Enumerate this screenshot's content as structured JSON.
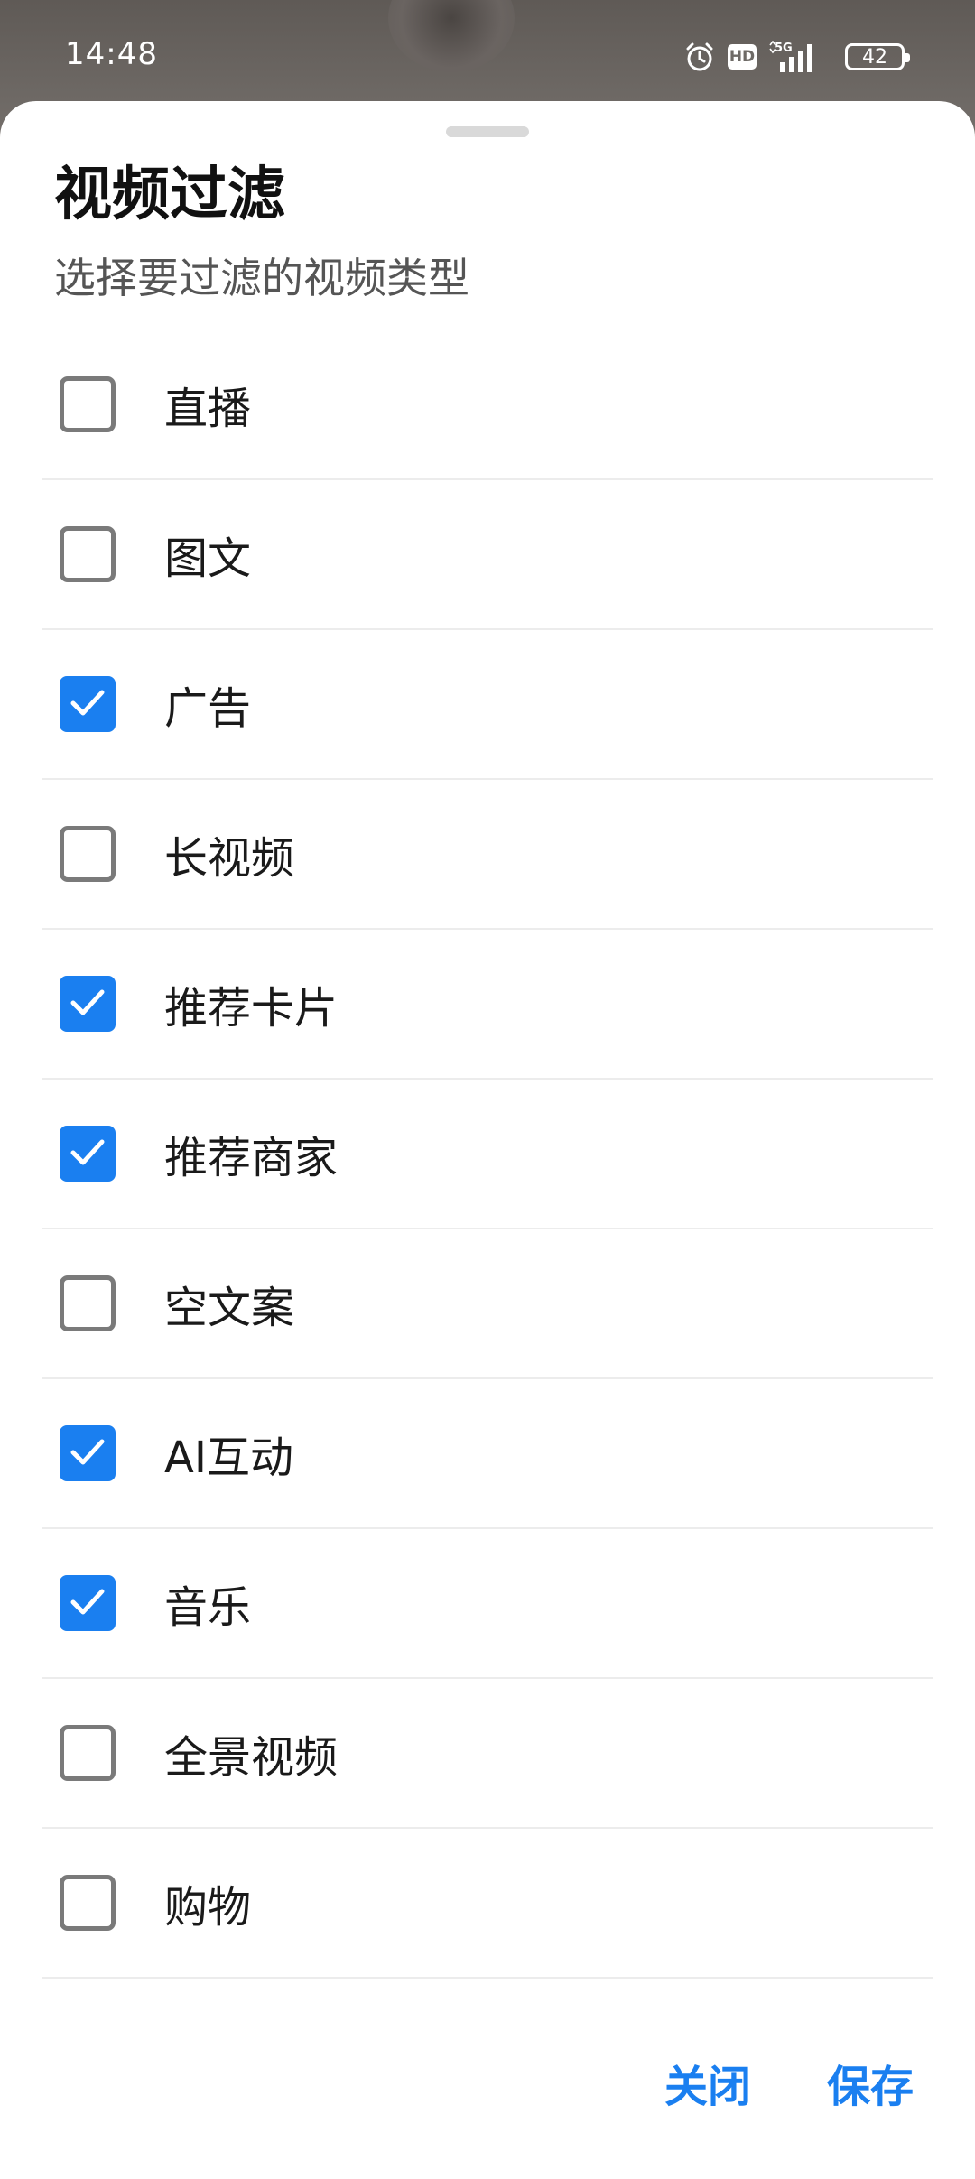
{
  "status_bar": {
    "time": "14:48",
    "battery": "42",
    "hd": "HD",
    "network": "5G",
    "icons": [
      "alarm-icon",
      "hd-icon",
      "signal-5g-icon",
      "battery-icon"
    ]
  },
  "sheet": {
    "title": "视频过滤",
    "subtitle": "选择要过滤的视频类型"
  },
  "filters": [
    {
      "label": "直播",
      "checked": false
    },
    {
      "label": "图文",
      "checked": false
    },
    {
      "label": "广告",
      "checked": true
    },
    {
      "label": "长视频",
      "checked": false
    },
    {
      "label": "推荐卡片",
      "checked": true
    },
    {
      "label": "推荐商家",
      "checked": true
    },
    {
      "label": "空文案",
      "checked": false
    },
    {
      "label": "AI互动",
      "checked": true
    },
    {
      "label": "音乐",
      "checked": true
    },
    {
      "label": "全景视频",
      "checked": false
    },
    {
      "label": "购物",
      "checked": false
    }
  ],
  "actions": {
    "close_label": "关闭",
    "save_label": "保存"
  },
  "colors": {
    "accent": "#1a7ff0",
    "checkbox_border": "#7a7a7a"
  },
  "nav": {
    "icons": [
      "menu-icon",
      "home-square-icon",
      "back-triangle-icon"
    ]
  }
}
